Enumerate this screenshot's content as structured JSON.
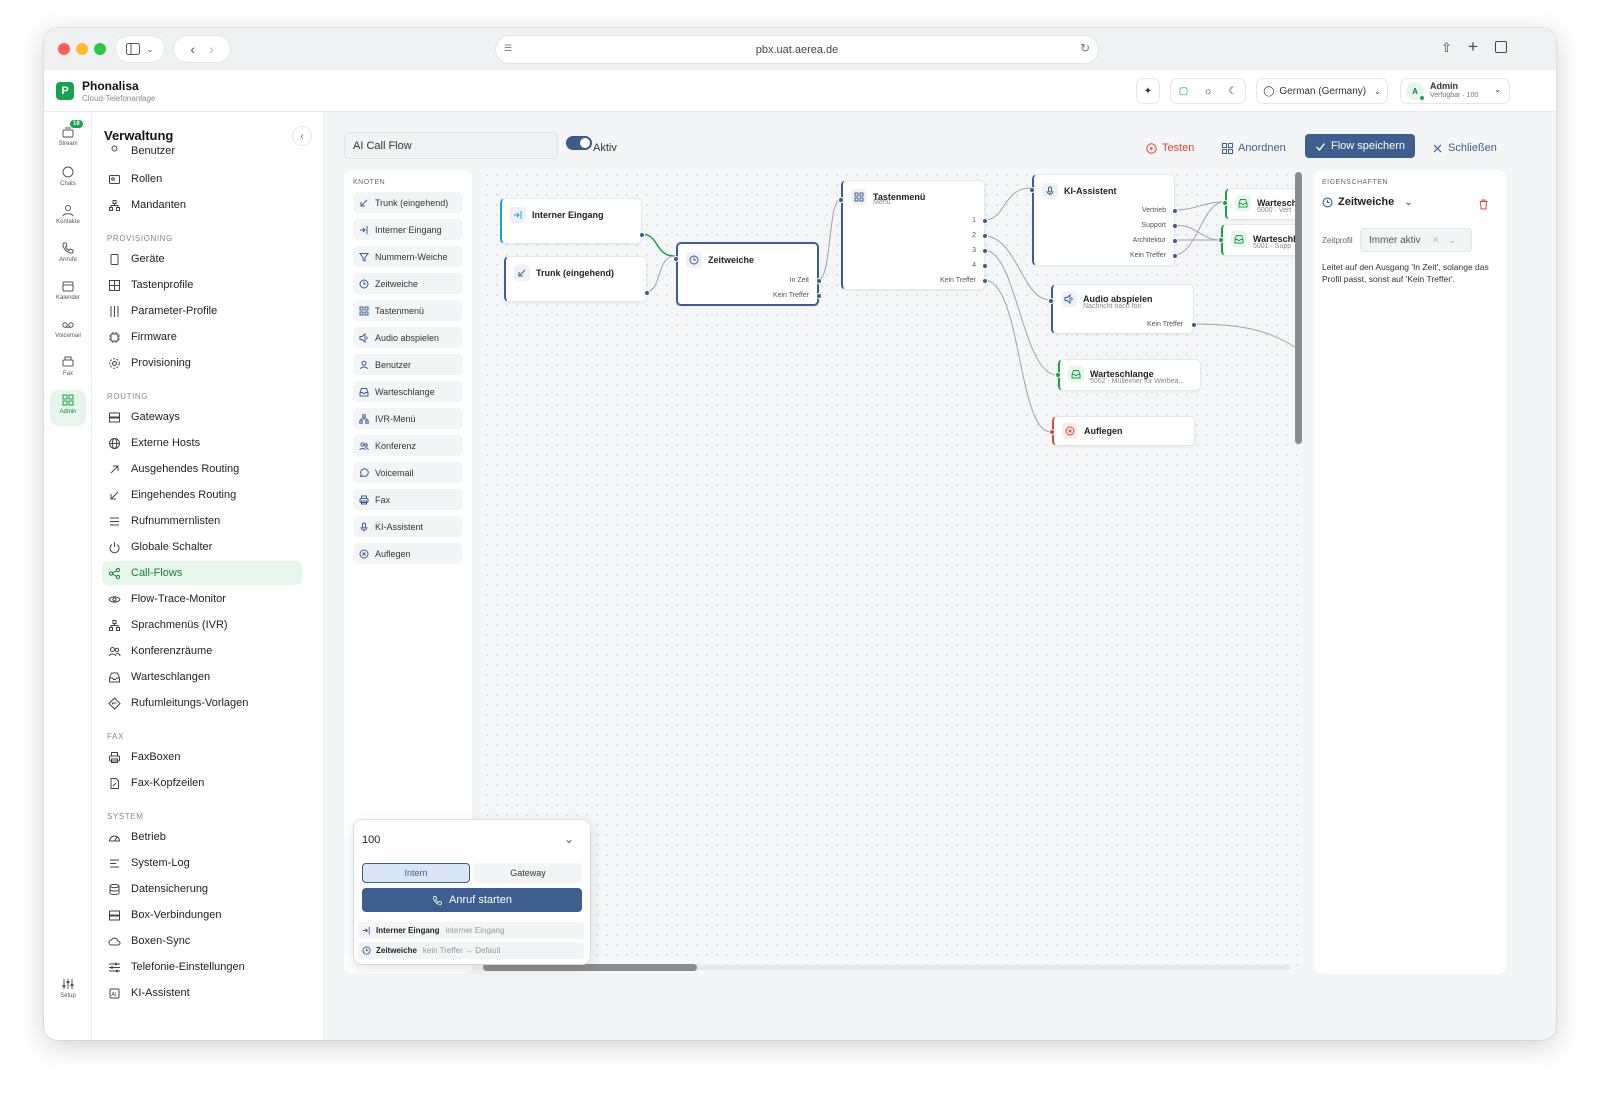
{
  "browser": {
    "url": "pbx.uat.aerea.de"
  },
  "brand": {
    "name": "Phonalisa",
    "subtitle": "Cloud-Telefonanlage",
    "logo_letter": "P"
  },
  "header": {
    "language": "German (Germany)",
    "user_name": "Admin",
    "user_status": "Verfügbar · 100",
    "avatar_letter": "A"
  },
  "rail": [
    {
      "label": "Stream",
      "icon": "stream-icon",
      "badge": "19"
    },
    {
      "label": "Chats",
      "icon": "chat-icon"
    },
    {
      "label": "Kontakte",
      "icon": "contact-icon"
    },
    {
      "label": "Anrufe",
      "icon": "phone-icon"
    },
    {
      "label": "Kalender",
      "icon": "calendar-icon"
    },
    {
      "label": "Voicemail",
      "icon": "voicemail-icon"
    },
    {
      "label": "Fax",
      "icon": "fax-icon"
    },
    {
      "label": "Admin",
      "icon": "admin-icon",
      "active": true
    },
    {
      "label": "Setup",
      "icon": "setup-icon"
    }
  ],
  "sidebar": {
    "title": "Verwaltung",
    "top_items": [
      "Benutzer",
      "Rollen",
      "Mandanten"
    ],
    "sections": [
      {
        "title": "PROVISIONING",
        "items": [
          "Geräte",
          "Tastenprofile",
          "Parameter-Profile",
          "Firmware",
          "Provisioning"
        ]
      },
      {
        "title": "ROUTING",
        "items": [
          "Gateways",
          "Externe Hosts",
          "Ausgehendes Routing",
          "Eingehendes Routing",
          "Rufnummernlisten",
          "Globale Schalter",
          "Call-Flows",
          "Flow-Trace-Monitor",
          "Sprachmenüs (IVR)",
          "Konferenzräume",
          "Warteschlangen",
          "Rufumleitungs-Vorlagen"
        ]
      },
      {
        "title": "FAX",
        "items": [
          "FaxBoxen",
          "Fax-Kopfzeilen"
        ]
      },
      {
        "title": "SYSTEM",
        "items": [
          "Betrieb",
          "System-Log",
          "Datensicherung",
          "Box-Verbindungen",
          "Boxen-Sync",
          "Telefonie-Einstellungen",
          "KI-Assistent"
        ]
      }
    ],
    "active_item": "Call-Flows"
  },
  "toolbar": {
    "flow_name": "AI Call Flow",
    "active_label": "Aktiv",
    "test_label": "Testen",
    "arrange_label": "Anordnen",
    "save_label": "Flow speichern",
    "close_label": "Schließen",
    "colors": {
      "test": "#e0453a",
      "accent": "#3d5f8f"
    }
  },
  "palette": {
    "title": "KNOTEN",
    "items": [
      {
        "label": "Trunk (eingehend)",
        "icon": "trunk-in-icon"
      },
      {
        "label": "Interner Eingang",
        "icon": "internal-in-icon"
      },
      {
        "label": "Nummern-Weiche",
        "icon": "filter-icon"
      },
      {
        "label": "Zeitweiche",
        "icon": "clock-icon"
      },
      {
        "label": "Tastenmenü",
        "icon": "grid-icon"
      },
      {
        "label": "Audio abspielen",
        "icon": "speaker-icon"
      },
      {
        "label": "Benutzer",
        "icon": "user-icon"
      },
      {
        "label": "Warteschlange",
        "icon": "queue-icon"
      },
      {
        "label": "IVR-Menü",
        "icon": "ivr-icon"
      },
      {
        "label": "Konferenz",
        "icon": "conference-icon"
      },
      {
        "label": "Voicemail",
        "icon": "voicemail-icon"
      },
      {
        "label": "Fax",
        "icon": "fax-icon"
      },
      {
        "label": "KI-Assistent",
        "icon": "ai-icon"
      },
      {
        "label": "Auflegen",
        "icon": "hangup-icon"
      }
    ]
  },
  "nodes": {
    "internal_in": {
      "title": "Interner Eingang"
    },
    "trunk_in": {
      "title": "Trunk (eingehend)"
    },
    "time_switch": {
      "title": "Zeitweiche",
      "outputs": [
        "In Zeit",
        "Kein Treffer"
      ]
    },
    "key_menu": {
      "title": "Tastenmenü",
      "subtitle": "Menü",
      "outputs": [
        "1",
        "2",
        "3",
        "4",
        "Kein Treffer"
      ]
    },
    "ai_assistant": {
      "title": "KI-Assistent",
      "outputs": [
        "Vertrieb",
        "Support",
        "Architektur",
        "Kein Treffer"
      ]
    },
    "queue_a": {
      "title": "Wartesch",
      "subtitle": "5000 · Vert"
    },
    "queue_b": {
      "title": "Warteschl",
      "subtitle": "5001 · Supp"
    },
    "audio": {
      "title": "Audio abspielen",
      "subtitle": "Nachricht nach ton",
      "outputs": [
        "Kein Treffer"
      ]
    },
    "queue_c": {
      "title": "Warteschlange",
      "subtitle": "5002 · Mülleimer für Werbea..."
    },
    "hangup": {
      "title": "Auflegen"
    }
  },
  "properties": {
    "title": "EIGENSCHAFTEN",
    "node_type": "Zeitweiche",
    "profile_label": "Zeitprofil",
    "profile_value": "Immer aktiv",
    "description": "Leitet auf den Ausgang 'In Zeit', solange das Profil passt, sonst auf 'Kein Treffer'."
  },
  "test_panel": {
    "number": "100",
    "tabs": [
      "Intern",
      "Gateway"
    ],
    "active_tab": "Intern",
    "start_label": "Anruf starten",
    "trace": [
      {
        "node": "Interner Eingang",
        "detail": "interner Eingang"
      },
      {
        "node": "Zeitweiche",
        "detail": "kein Treffer → Default"
      }
    ]
  }
}
